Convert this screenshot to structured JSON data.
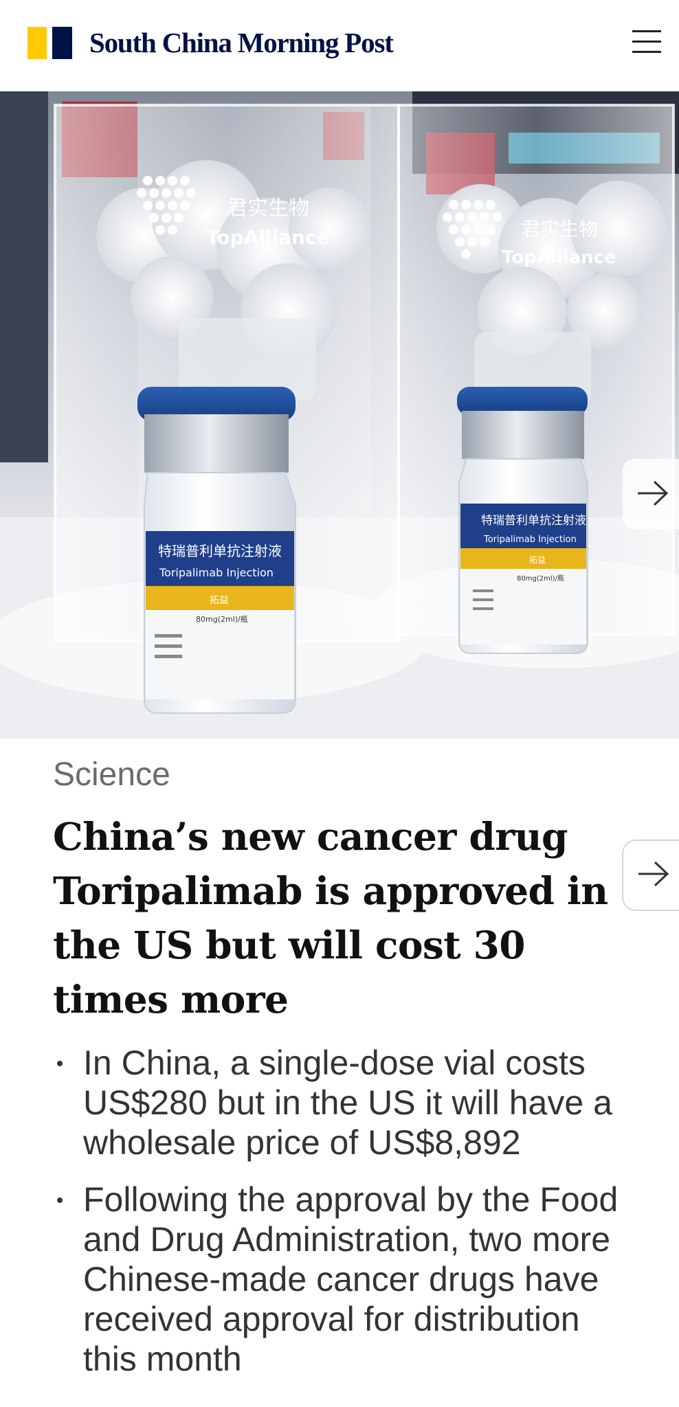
{
  "header": {
    "brand_name": "South China Morning Post",
    "logo_colors": {
      "yellow": "#FFCA05",
      "navy": "#001246"
    },
    "menu_icon": "hamburger-menu-icon"
  },
  "hero": {
    "alt": "",
    "image_text": {
      "brand_cn": "君实生物",
      "brand_en": "TopAlliance",
      "label_cn": "特瑞普利单抗注射液",
      "label_en": "Toripalimab Injection",
      "label_band": "拓益",
      "dose": "80mg(2ml)/瓶"
    },
    "next_icon": "arrow-right-icon"
  },
  "article": {
    "section": "Science",
    "headline": "China’s new cancer drug Toripalimab is approved in the US but will cost 30 times more",
    "summary": [
      "In China, a single-dose vial costs US$280 but in the US it will have a wholesale price of US$8,892",
      "Following the approval by the Food and Drug Administration, two more Chinese-made cancer drugs have received approval for distribution this month"
    ],
    "next_article_icon": "arrow-right-icon"
  }
}
